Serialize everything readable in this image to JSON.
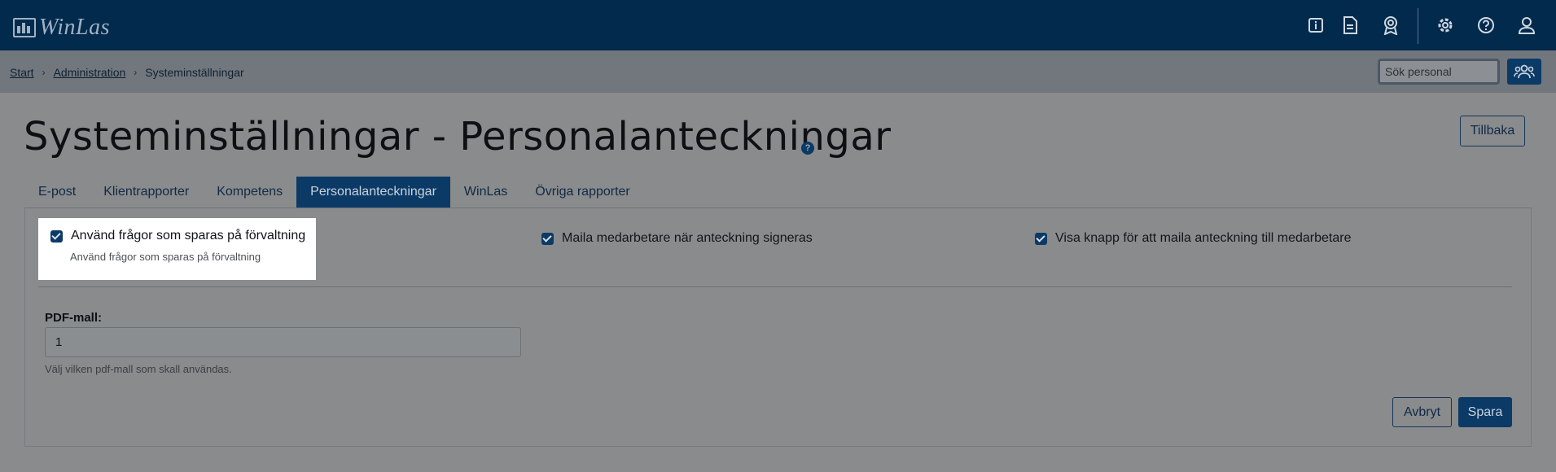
{
  "app": {
    "logo_text": "WinLas"
  },
  "topbar": {
    "icons": [
      "info-icon",
      "document-icon",
      "award-icon",
      "gear-icon",
      "help-icon",
      "user-icon"
    ]
  },
  "breadcrumb": {
    "items": [
      "Start",
      "Administration",
      "Systeminställningar"
    ]
  },
  "search": {
    "placeholder": "Sök personal"
  },
  "page": {
    "title": "Systeminställningar - Personalanteckningar",
    "help_glyph": "?",
    "back_label": "Tillbaka"
  },
  "tabs": [
    {
      "label": "E-post",
      "active": false
    },
    {
      "label": "Klientrapporter",
      "active": false
    },
    {
      "label": "Kompetens",
      "active": false
    },
    {
      "label": "Personalanteckningar",
      "active": true
    },
    {
      "label": "WinLas",
      "active": false
    },
    {
      "label": "Övriga rapporter",
      "active": false
    }
  ],
  "options": [
    {
      "label": "Använd frågor som sparas på förvaltning",
      "help": "Använd frågor som sparas på förvaltning",
      "checked": true
    },
    {
      "label": "Maila medarbetare när anteckning signeras",
      "checked": true
    },
    {
      "label": "Visa knapp för att maila anteckning till medarbetare",
      "checked": true
    }
  ],
  "pdf": {
    "label": "PDF-mall:",
    "value": "1",
    "help": "Välj vilken pdf-mall som skall användas."
  },
  "actions": {
    "cancel": "Avbryt",
    "save": "Spara"
  },
  "colors": {
    "topbar": "#022a4c",
    "accent": "#0b3a66"
  }
}
